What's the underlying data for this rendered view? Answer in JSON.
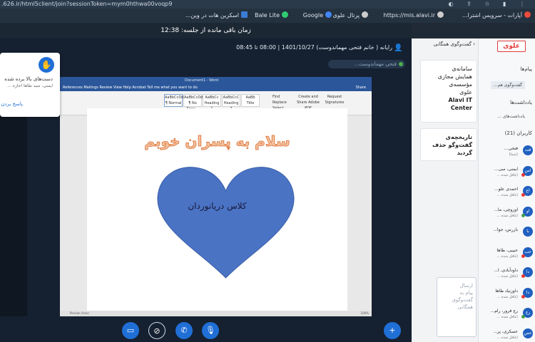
{
  "browser": {
    "url": ".626.ir/html5client/join?sessionToken=mym0hthwa00voqp9",
    "bookmarks": [
      "آپارات - سرویس اشترا...",
      "https://mis.alavi.ir",
      "پرتال علوی",
      "Google",
      "Bale Lite",
      "اسکرین هات در وین..."
    ]
  },
  "timer": {
    "text": "زمان باقی مانده از جلسه: 12:38"
  },
  "session": {
    "info": "رایانه ( خانم فتحی مهماندوست) 1401/10/27 | 08:00 تا 08:45",
    "presenter": "فتحی مهماندوست..."
  },
  "hand_popup": {
    "line1": "دست‌های بالا برده شده",
    "line2": "ایمنی، سید طاها اجازه ...",
    "link": "پاسخ بردن"
  },
  "word": {
    "title": "Document1 - Word",
    "menus": "References   Mailings   Review   View   Help   Acrobat   Tell me what you want to do",
    "share": "Share",
    "ribbon": {
      "styles": [
        "AaBbCcDd",
        "AaBbCcDd",
        "AaBbCc",
        "AaBbCcC",
        "AaBb"
      ],
      "style_names": [
        "¶ Normal",
        "¶ No Spac...",
        "Heading 1",
        "Heading 2",
        "Title"
      ],
      "group_labels": [
        "Font",
        "Paragraph",
        "Styles",
        "Editing",
        "Adobe Acrobat"
      ],
      "editing": [
        "Find",
        "Replace",
        "Select"
      ],
      "acrobat": [
        "Create and Share Adobe PDF",
        "Request Signatures"
      ]
    },
    "heading": "سلام به پسران خوبم",
    "heart_label": "کلاس دریانوردان",
    "status": "Persian (Iran)",
    "zoom": "100%"
  },
  "chat": {
    "header": "گفت‌وگوی همگانی",
    "message1": [
      "سامانه‌ی",
      "همایش مجازی",
      "مؤسسه‌ی",
      "علوی",
      "",
      "Alavi IT",
      "Center"
    ],
    "message2": [
      "تاریخچه‌ی",
      "گفت‌وگو حذف",
      "گردید"
    ],
    "input_placeholder": [
      "ارسال",
      "پیام به",
      "گفت‌وگوی",
      "همگانی"
    ]
  },
  "sidebar": {
    "brand": "علوی",
    "messages_label": "پیام‌ها",
    "public_chat": "گفت‌وگوی هم...",
    "notes_label": "یادداشت‌ها",
    "shared_notes": "یادداشت‌های ...",
    "users_label": "کاربران (21)",
    "users": [
      {
        "initial": "فت",
        "name": "فتحی...",
        "sub": "(شما)",
        "mic": "none"
      },
      {
        "initial": "اس",
        "name": "ایمنی، سی...",
        "sub": "(غافل شده ...",
        "mic": "red"
      },
      {
        "initial": "اع",
        "name": "احمدی علو...",
        "sub": "(غافل شده ...",
        "mic": "red"
      },
      {
        "initial": "او",
        "name": "اوزوچی، ما...",
        "sub": "(غافل شده ...",
        "mic": "green"
      },
      {
        "initial": "با",
        "name": "بازرس، جوا...",
        "sub": "",
        "mic": "none"
      },
      {
        "initial": "حب",
        "name": "حبیبی، طاها",
        "sub": "(غافل شده ...",
        "mic": "red"
      },
      {
        "initial": "دا",
        "name": "داودآبادی، ا...",
        "sub": "(غافل شده ...",
        "mic": "red"
      },
      {
        "initial": "دا",
        "name": "داوزنیاد طاها",
        "sub": "(غافل شده ...",
        "mic": "red"
      },
      {
        "initial": "رج",
        "name": "رج فرور، رام...",
        "sub": "(غافل شده ...",
        "mic": "green"
      },
      {
        "initial": "عس",
        "name": "عسکری، پر...",
        "sub": "(غافل شده ...",
        "mic": "none"
      }
    ]
  },
  "colors": {
    "accent": "#1f6fd6",
    "brand": "#e23b3b",
    "heart": "#4a73c4"
  }
}
